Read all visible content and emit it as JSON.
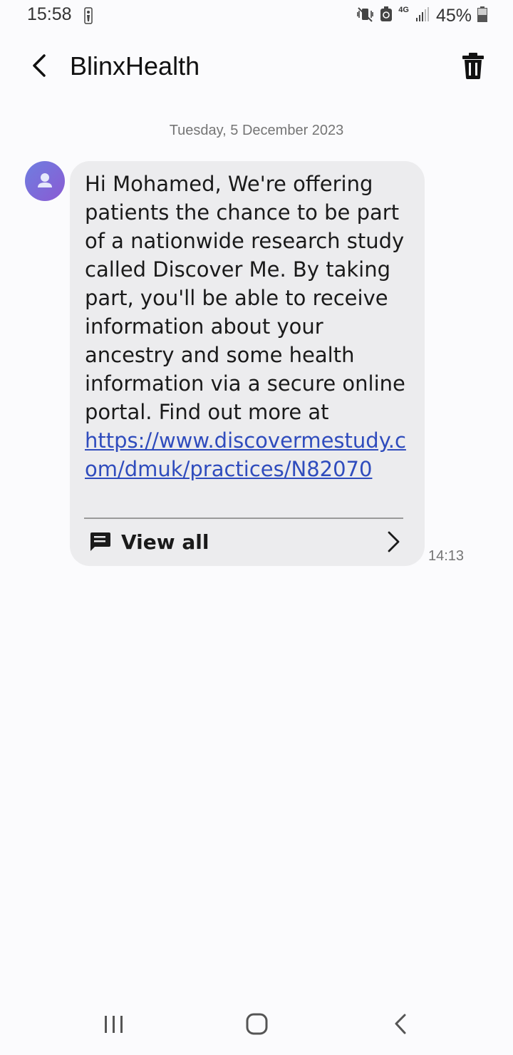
{
  "status_bar": {
    "time": "15:58",
    "network": "4G",
    "battery": "45%",
    "icons": [
      "nba-icon",
      "mute-vibrate-icon",
      "data-saver-icon",
      "signal-icon",
      "battery-icon"
    ]
  },
  "header": {
    "title": "BlinxHealth",
    "back_icon": "chevron-left-icon",
    "delete_icon": "trash-icon"
  },
  "conversation": {
    "date": "Tuesday, 5 December 2023",
    "message": {
      "text_before_link": "Hi Mohamed, We're offering patients the chance to be part of a nationwide research study called Discover Me. By taking part, you'll be able to receive information about your ancestry and some health information via a secure online portal. Find out more at ",
      "link": "https://www.discovermestudy.com/dmuk/practices/N82070",
      "view_all_label": "View all",
      "time": "14:13"
    }
  },
  "nav_bar": {
    "buttons": [
      "recent-apps",
      "home",
      "back"
    ]
  },
  "colors": {
    "background": "#fbfbfd",
    "bubble": "#ececee",
    "link": "#2f4cbd",
    "avatar_gradient_start": "#6f7ee0",
    "avatar_gradient_end": "#8a5ad3"
  }
}
